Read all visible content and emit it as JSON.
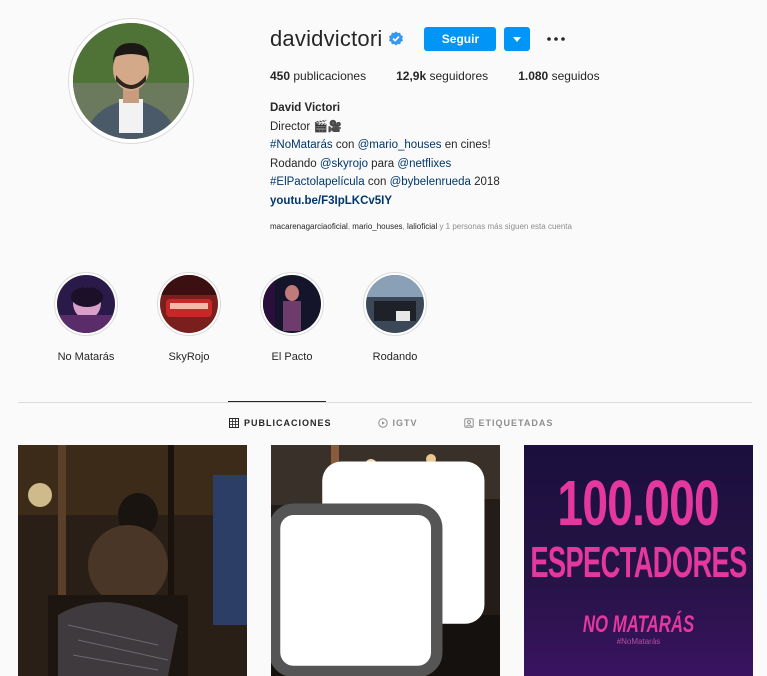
{
  "profile": {
    "username": "davidvictori",
    "verified": true,
    "follow_label": "Seguir",
    "stats": {
      "posts_count": "450",
      "posts_label": "publicaciones",
      "followers_count": "12,9k",
      "followers_label": "seguidores",
      "following_count": "1.080",
      "following_label": "seguidos"
    }
  },
  "bio": {
    "name": "David Victori",
    "line1": "Director 🎬🎥",
    "line2_hash": "#NoMatarás",
    "line2_mid": " con ",
    "line2_mention": "@mario_houses",
    "line2_tail": " en cines!",
    "line3_pre": "Rodando ",
    "line3_mention1": "@skyrojo",
    "line3_mid": " para ",
    "line3_mention2": "@netflixes",
    "line4_hash": "#ElPactolapelícula",
    "line4_mid": " con ",
    "line4_mention": "@bybelenrueda",
    "line4_tail": " 2018",
    "url": "youtu.be/F3IpLKCv5IY"
  },
  "followed_by": {
    "user1": "macarenagarciaoficial",
    "sep1": ", ",
    "user2": "mario_houses",
    "sep2": ", ",
    "user3": "lalioficial",
    "tail": " y 1 personas más siguen esta cuenta"
  },
  "highlights": [
    {
      "label": "No Matarás"
    },
    {
      "label": "SkyRojo"
    },
    {
      "label": "El Pacto"
    },
    {
      "label": "Rodando"
    }
  ],
  "tabs": [
    {
      "label": "PUBLICACIONES",
      "icon": "grid-icon",
      "active": true
    },
    {
      "label": "IGTV",
      "icon": "igtv-icon",
      "active": false
    },
    {
      "label": "ETIQUETADAS",
      "icon": "tagged-icon",
      "active": false
    }
  ],
  "posts": [
    {
      "type": "photo",
      "icon": "photo-dark-scene"
    },
    {
      "type": "carousel",
      "icon": "photo-film-set"
    },
    {
      "type": "poster",
      "big_text": "100.000",
      "mid_text": "ESPECTADORES",
      "small_text": "NO MATARÁS",
      "tiny_text": "#NoMatarás"
    }
  ],
  "colors": {
    "accent": "#0095f6",
    "link": "#00376b",
    "poster_text": "#e4389f",
    "poster_bg": "#251345"
  }
}
